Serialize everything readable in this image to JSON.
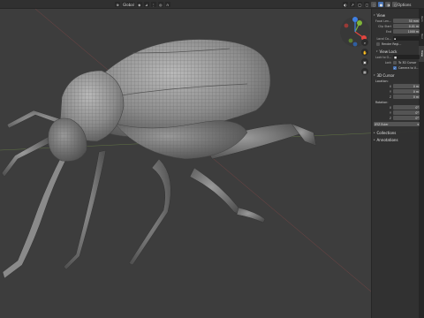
{
  "header": {
    "mode_label": "Global",
    "right_tab_label": "Options"
  },
  "gizmo": {
    "axes": [
      "X",
      "Y",
      "Z"
    ],
    "colors": {
      "x": "#e2453f",
      "y": "#7fb538",
      "z": "#3f7fe2"
    }
  },
  "sidebar": {
    "tabs": [
      "Item",
      "Tool",
      "View"
    ],
    "view": {
      "title": "View",
      "focal_length_label": "Focal Len...",
      "focal_length_value": "50 mm",
      "clip_start_label": "Clip Start",
      "clip_start_value": "0.01 m",
      "clip_end_label": "End",
      "clip_end_value": "1000 m",
      "local_camera_label": "Local Ca...",
      "render_region_label": "Render Regi..."
    },
    "view_lock": {
      "title": "View Lock",
      "lock_to_object_label": "Lock to O...",
      "lock_label": "Lock",
      "to_3d_cursor_label": "To 3D Cursor",
      "camera_to_view_label": "Camera to V..."
    },
    "cursor": {
      "title": "3D Cursor",
      "location_label": "Location:",
      "location": [
        {
          "axis": "X",
          "value": "0 m"
        },
        {
          "axis": "Y",
          "value": "0 m"
        },
        {
          "axis": "Z",
          "value": "0 m"
        }
      ],
      "rotation_label": "Rotation:",
      "rotation": [
        {
          "axis": "X",
          "value": "0°"
        },
        {
          "axis": "Y",
          "value": "0°"
        },
        {
          "axis": "Z",
          "value": "0°"
        }
      ],
      "rotation_mode": "XYZ Euler"
    },
    "collections_title": "Collections",
    "annotations_title": "Annotations"
  },
  "colors": {
    "viewport_bg": "#3d3d3d",
    "panel_bg": "#303030",
    "accent": "#4772b3",
    "wire": "#2a2a2a",
    "mesh": "#9a9a9a"
  }
}
